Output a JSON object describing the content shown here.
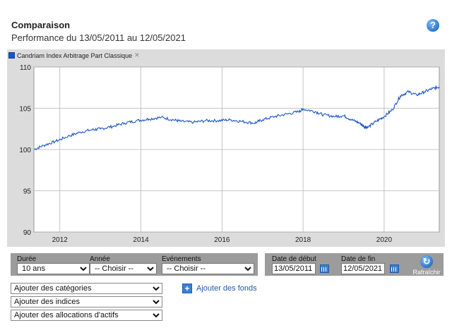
{
  "header": {
    "title": "Comparaison",
    "subtitle": "Performance du 13/05/2011 au 12/05/2021",
    "help_symbol": "?"
  },
  "legend": {
    "label": "Candriam Index Arbitrage Part Classique",
    "remove_symbol": "✕",
    "color": "#1a55c7"
  },
  "chart_data": {
    "type": "line",
    "title": "",
    "xlabel": "",
    "ylabel": "",
    "ylim": [
      90,
      110
    ],
    "xlim": [
      2011.36,
      2021.36
    ],
    "y_ticks": [
      90,
      95,
      100,
      105,
      110
    ],
    "x_ticks": [
      2012,
      2014,
      2016,
      2018,
      2020
    ],
    "grid": true,
    "series": [
      {
        "name": "Candriam Index Arbitrage Part Classique",
        "color": "#1a55c7",
        "x": [
          2011.36,
          2011.6,
          2011.9,
          2012.2,
          2012.5,
          2012.8,
          2013.0,
          2013.3,
          2013.6,
          2013.9,
          2014.2,
          2014.5,
          2014.8,
          2015.0,
          2015.3,
          2015.6,
          2015.9,
          2016.2,
          2016.5,
          2016.8,
          2017.0,
          2017.3,
          2017.6,
          2017.9,
          2018.0,
          2018.3,
          2018.5,
          2018.8,
          2019.0,
          2019.2,
          2019.4,
          2019.5,
          2019.6,
          2019.8,
          2020.0,
          2020.2,
          2020.4,
          2020.6,
          2020.8,
          2021.0,
          2021.2,
          2021.36
        ],
        "values": [
          100.0,
          100.5,
          101.0,
          101.6,
          102.1,
          102.4,
          102.5,
          102.8,
          103.2,
          103.5,
          103.7,
          103.9,
          103.6,
          103.4,
          103.3,
          103.5,
          103.5,
          103.6,
          103.4,
          103.2,
          103.6,
          104.0,
          104.3,
          104.6,
          104.9,
          104.6,
          104.2,
          104.0,
          104.1,
          103.6,
          103.2,
          102.8,
          102.7,
          103.4,
          104.0,
          104.8,
          106.5,
          107.0,
          106.6,
          107.0,
          107.4,
          107.6
        ]
      }
    ]
  },
  "controls": {
    "duree": {
      "label": "Durée",
      "value": "10 ans"
    },
    "annee": {
      "label": "Année",
      "value": "-- Choisir --"
    },
    "evenements": {
      "label": "Evénements",
      "value": "-- Choisir --"
    },
    "date_debut": {
      "label": "Date de début",
      "value": "13/05/2011"
    },
    "date_fin": {
      "label": "Date de fin",
      "value": "12/05/2021"
    },
    "refresh_label": "Rafraîchir"
  },
  "add_selects": {
    "categories": "Ajouter des catégories",
    "indices": "Ajouter des indices",
    "allocations": "Ajouter des allocations d'actifs"
  },
  "add_fund": {
    "label": "Ajouter des fonds",
    "symbol": "+"
  }
}
